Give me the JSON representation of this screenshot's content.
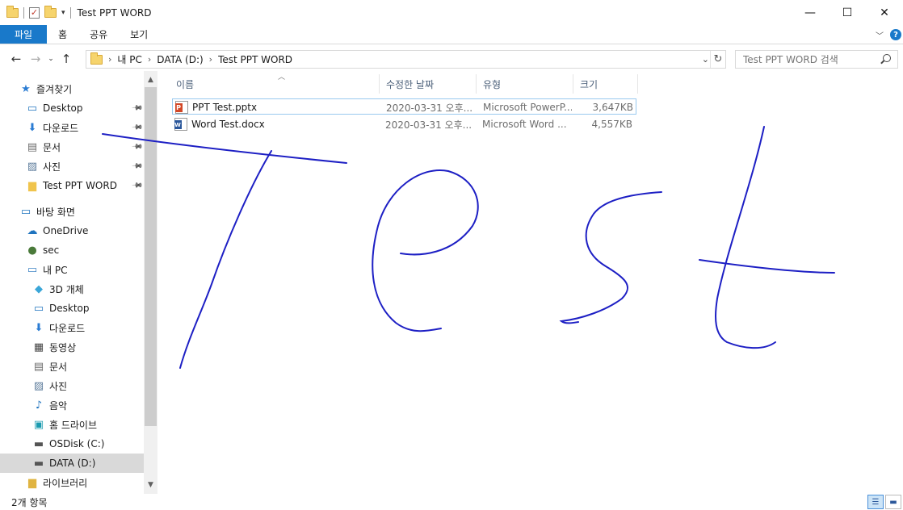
{
  "window": {
    "title": "Test PPT WORD",
    "minimize_symbol": "—",
    "maximize_symbol": "☐",
    "close_symbol": "✕"
  },
  "ribbon": {
    "tabs": [
      "파일",
      "홈",
      "공유",
      "보기"
    ],
    "accent_color": "#1979ca",
    "help_label": "?"
  },
  "address": {
    "path": [
      "내 PC",
      "DATA (D:)",
      "Test PPT WORD"
    ]
  },
  "search": {
    "placeholder": "Test PPT WORD 검색"
  },
  "sidebar": {
    "items": [
      {
        "label": "즐겨찾기",
        "icon": "star-icon",
        "pinned": false,
        "selected": false
      },
      {
        "label": "Desktop",
        "icon": "desktop-icon",
        "pinned": true,
        "selected": false
      },
      {
        "label": "다운로드",
        "icon": "download-icon",
        "pinned": true,
        "selected": false
      },
      {
        "label": "문서",
        "icon": "document-icon",
        "pinned": true,
        "selected": false
      },
      {
        "label": "사진",
        "icon": "picture-icon",
        "pinned": true,
        "selected": false
      },
      {
        "label": "Test PPT WORD",
        "icon": "folder-icon",
        "pinned": true,
        "selected": false
      },
      {
        "label": "바탕 화면",
        "icon": "desktop-icon",
        "pinned": false,
        "selected": false
      },
      {
        "label": "OneDrive",
        "icon": "cloud-icon",
        "pinned": false,
        "selected": false
      },
      {
        "label": "sec",
        "icon": "user-icon",
        "pinned": false,
        "selected": false
      },
      {
        "label": "내 PC",
        "icon": "computer-icon",
        "pinned": false,
        "selected": false
      },
      {
        "label": "3D 개체",
        "icon": "cube-icon",
        "pinned": false,
        "selected": false
      },
      {
        "label": "Desktop",
        "icon": "desktop-icon",
        "pinned": false,
        "selected": false
      },
      {
        "label": "다운로드",
        "icon": "download-icon",
        "pinned": false,
        "selected": false
      },
      {
        "label": "동영상",
        "icon": "video-icon",
        "pinned": false,
        "selected": false
      },
      {
        "label": "문서",
        "icon": "document-icon",
        "pinned": false,
        "selected": false
      },
      {
        "label": "사진",
        "icon": "picture-icon",
        "pinned": false,
        "selected": false
      },
      {
        "label": "음악",
        "icon": "music-icon",
        "pinned": false,
        "selected": false
      },
      {
        "label": "홈 드라이브",
        "icon": "home-drive-icon",
        "pinned": false,
        "selected": false
      },
      {
        "label": "OSDisk (C:)",
        "icon": "drive-icon",
        "pinned": false,
        "selected": false
      },
      {
        "label": "DATA (D:)",
        "icon": "drive-icon",
        "pinned": false,
        "selected": true
      },
      {
        "label": "라이브러리",
        "icon": "library-icon",
        "pinned": false,
        "selected": false
      }
    ]
  },
  "columns": [
    "이름",
    "수정한 날짜",
    "유형",
    "크기"
  ],
  "files": [
    {
      "name": "PPT Test.pptx",
      "date": "2020-03-31 오후...",
      "type": "Microsoft PowerP...",
      "size": "3,647KB",
      "icon": "powerpoint-file-icon"
    },
    {
      "name": "Word Test.docx",
      "date": "2020-03-31 오후...",
      "type": "Microsoft Word ...",
      "size": "4,557KB",
      "icon": "word-file-icon"
    }
  ],
  "status": {
    "item_count": "2개 항목"
  },
  "ink": {
    "color": "#1d1fc4"
  }
}
